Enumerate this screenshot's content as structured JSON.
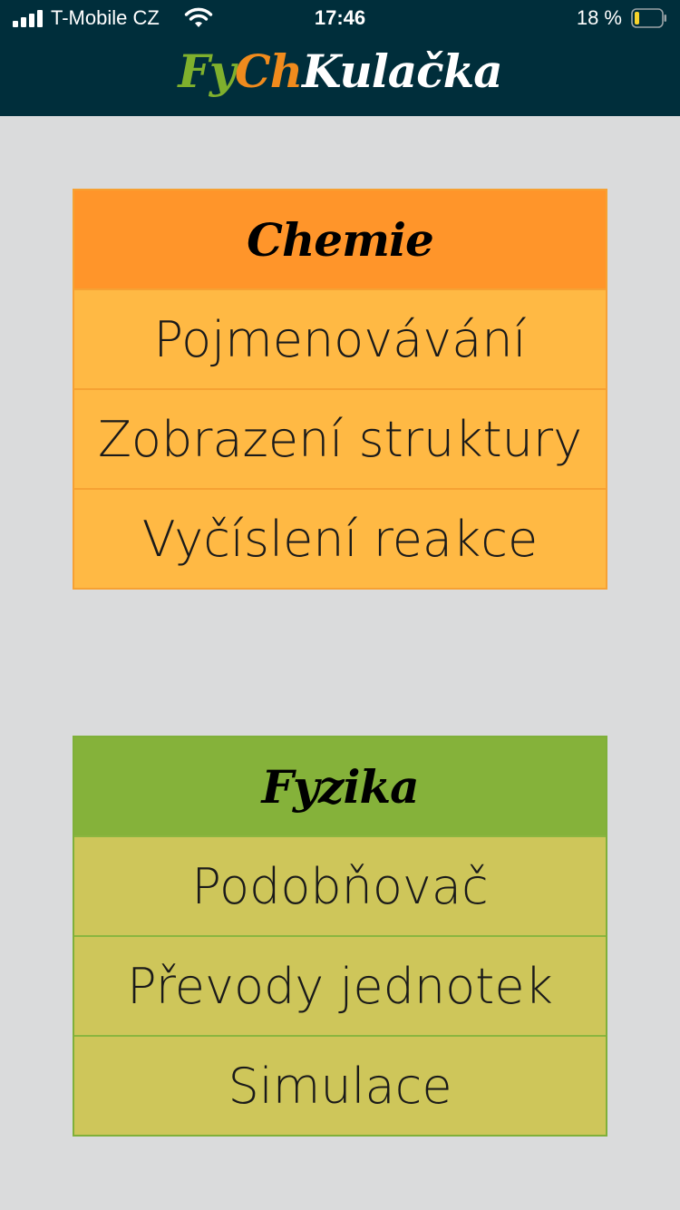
{
  "status_bar": {
    "carrier": "T-Mobile CZ",
    "time": "17:46",
    "battery_percent": "18 %",
    "battery_level": 0.18
  },
  "app": {
    "title_part1": "Fy",
    "title_part2": "Ch",
    "title_part3": "Kulačka",
    "colors": {
      "header_bg": "#002e3b",
      "title_fy": "#7fb02d",
      "title_ch": "#f08b1d",
      "title_rest": "#ffffff",
      "page_bg": "#dadbdc"
    }
  },
  "categories": [
    {
      "title": "Chemie",
      "header_color": "#ff952a",
      "item_color": "#ffb944",
      "items": [
        {
          "label": "Pojmenovávání"
        },
        {
          "label": "Zobrazení struktury"
        },
        {
          "label": "Vyčíslení reakce"
        }
      ]
    },
    {
      "title": "Fyzika",
      "header_color": "#85b23a",
      "item_color": "#cec65a",
      "items": [
        {
          "label": "Podobňovač"
        },
        {
          "label": "Převody jednotek"
        },
        {
          "label": "Simulace"
        }
      ]
    }
  ]
}
